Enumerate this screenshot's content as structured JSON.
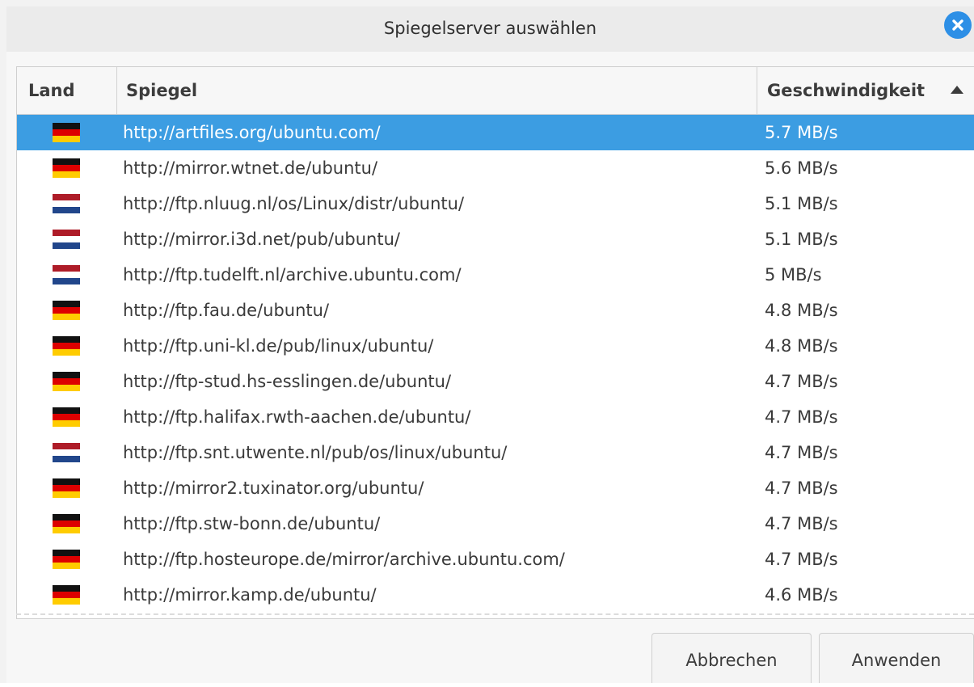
{
  "dialog": {
    "title": "Spiegelserver auswählen"
  },
  "table": {
    "columns": {
      "land": "Land",
      "spiegel": "Spiegel",
      "speed": "Geschwindigkeit"
    },
    "sort_direction": "ascending-arrow",
    "rows": [
      {
        "country": "DE",
        "url": "http://artfiles.org/ubuntu.com/",
        "speed": "5.7 MB/s",
        "selected": true
      },
      {
        "country": "DE",
        "url": "http://mirror.wtnet.de/ubuntu/",
        "speed": "5.6 MB/s"
      },
      {
        "country": "NL",
        "url": "http://ftp.nluug.nl/os/Linux/distr/ubuntu/",
        "speed": "5.1 MB/s"
      },
      {
        "country": "NL",
        "url": "http://mirror.i3d.net/pub/ubuntu/",
        "speed": "5.1 MB/s"
      },
      {
        "country": "NL",
        "url": "http://ftp.tudelft.nl/archive.ubuntu.com/",
        "speed": "5 MB/s"
      },
      {
        "country": "DE",
        "url": "http://ftp.fau.de/ubuntu/",
        "speed": "4.8 MB/s"
      },
      {
        "country": "DE",
        "url": "http://ftp.uni-kl.de/pub/linux/ubuntu/",
        "speed": "4.8 MB/s"
      },
      {
        "country": "DE",
        "url": "http://ftp-stud.hs-esslingen.de/ubuntu/",
        "speed": "4.7 MB/s"
      },
      {
        "country": "DE",
        "url": "http://ftp.halifax.rwth-aachen.de/ubuntu/",
        "speed": "4.7 MB/s"
      },
      {
        "country": "NL",
        "url": "http://ftp.snt.utwente.nl/pub/os/linux/ubuntu/",
        "speed": "4.7 MB/s"
      },
      {
        "country": "DE",
        "url": "http://mirror2.tuxinator.org/ubuntu/",
        "speed": "4.7 MB/s"
      },
      {
        "country": "DE",
        "url": "http://ftp.stw-bonn.de/ubuntu/",
        "speed": "4.7 MB/s"
      },
      {
        "country": "DE",
        "url": "http://ftp.hosteurope.de/mirror/archive.ubuntu.com/",
        "speed": "4.7 MB/s"
      },
      {
        "country": "DE",
        "url": "http://mirror.kamp.de/ubuntu/",
        "speed": "4.6 MB/s"
      }
    ]
  },
  "buttons": {
    "cancel": "Abbrechen",
    "apply": "Anwenden"
  },
  "colors": {
    "selection": "#3c9de2",
    "close_button": "#2d8fe6",
    "flag_de": [
      "#111111",
      "#dd0000",
      "#ffcc00"
    ],
    "flag_nl": [
      "#ae1c28",
      "#ffffff",
      "#21468b"
    ]
  }
}
